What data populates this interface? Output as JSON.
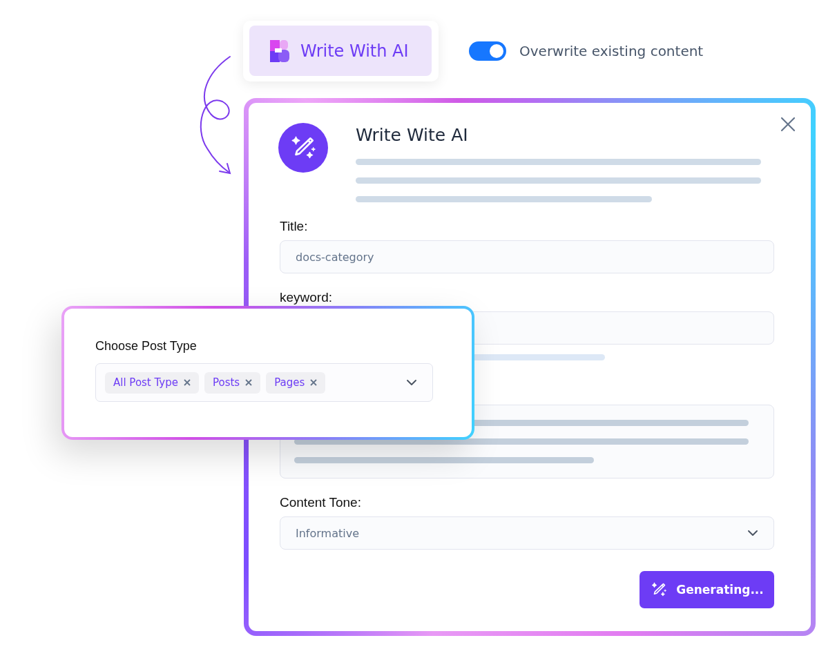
{
  "header_button": {
    "label": "Write With AI"
  },
  "toggle": {
    "label": "Overwrite existing content",
    "on": true
  },
  "dialog": {
    "title": "Write Wite AI",
    "fields": [
      {
        "kind": "input",
        "label": "Title:",
        "value": "docs-category",
        "hint": false
      },
      {
        "kind": "input",
        "label": "keyword:",
        "hint": true
      },
      {
        "kind": "textarea"
      },
      {
        "kind": "select",
        "label": "Content Tone:",
        "value": "Informative"
      }
    ],
    "button": {
      "label": "Generating..."
    }
  },
  "post_type_popup": {
    "label": "Choose Post Type",
    "chips": [
      {
        "label": "All Post Type"
      },
      {
        "label": "Posts"
      },
      {
        "label": "Pages"
      }
    ]
  }
}
